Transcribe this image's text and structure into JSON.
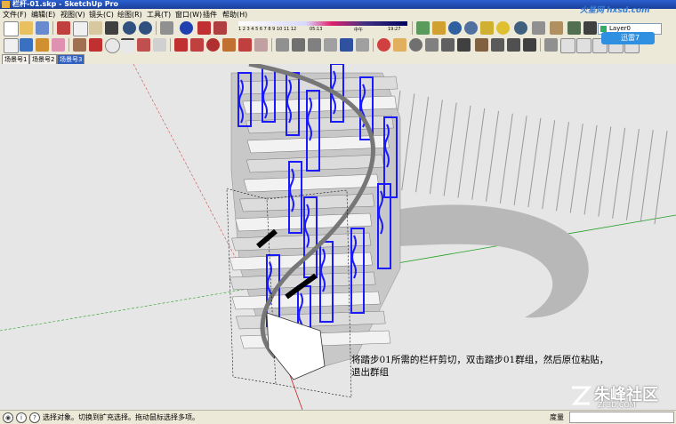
{
  "window": {
    "title": "栏杆-01.skp - SketchUp Pro"
  },
  "menu": {
    "items": [
      "文件(F)",
      "编辑(E)",
      "视图(V)",
      "镜头(C)",
      "绘图(R)",
      "工具(T)",
      "窗口(W)",
      "插件",
      "帮助(H)"
    ]
  },
  "shadow_settings": {
    "months": "1 2 3 4 5 6 7 8 9 10 11 12",
    "time_start": "05:13",
    "time_mid": "中午",
    "time_end": "19:27"
  },
  "layer": {
    "current": "Layer0"
  },
  "scenes": {
    "tabs": [
      "场景号1",
      "场景号2",
      "场景号3"
    ],
    "active_index": 2
  },
  "annotation": {
    "line1": "将踏步01所需的栏杆剪切，双击踏步01群组，然后原位粘贴，",
    "line2": "退出群组"
  },
  "status": {
    "text": "选择对象。切换到扩充选择。拖动鼠标选择多项。",
    "measure_label": "度量",
    "measure_value": ""
  },
  "watermarks": {
    "top": "火星网 hxsd.com",
    "badge": "迅雷7",
    "bottom": "朱峰社区",
    "bottom_url": "ZF3D.COM"
  },
  "colors": {
    "selection_blue": "#1a1aff",
    "title_bar": "#2a5fd0",
    "axis_red": "#cc2020",
    "axis_green": "#20a020"
  }
}
